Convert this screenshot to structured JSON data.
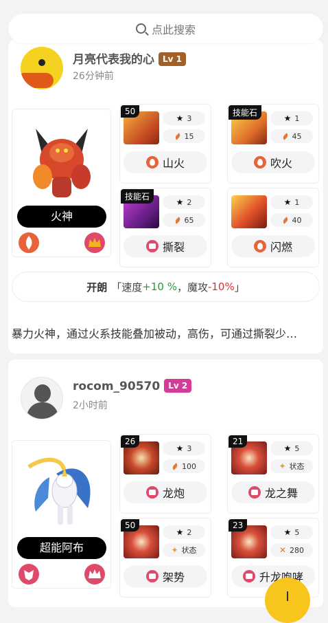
{
  "search": {
    "placeholder": "点此搜索"
  },
  "posts": [
    {
      "username": "月亮代表我的心",
      "level": "Lv 1",
      "level_color": "#a0602a",
      "time": "26分钟前",
      "monster": {
        "name": "火神",
        "types": [
          "fire-icon",
          "crown-icon"
        ]
      },
      "skills": [
        {
          "tag": "50",
          "stars": "3",
          "stat": "15",
          "stat_icon": "leaf-icon",
          "name": "山火",
          "element": "fire"
        },
        {
          "tag": "技能石",
          "stars": "1",
          "stat": "45",
          "stat_icon": "leaf-icon",
          "name": "吹火",
          "element": "fire"
        },
        {
          "tag": "技能石",
          "stars": "2",
          "stat": "65",
          "stat_icon": "leaf-icon",
          "name": "撕裂",
          "element": "fight"
        },
        {
          "tag": "",
          "stars": "1",
          "stat": "40",
          "stat_icon": "leaf-icon",
          "name": "闪燃",
          "element": "fire"
        }
      ],
      "nature": {
        "name": "开朗",
        "open": "「速度 ",
        "up": "+10 %",
        "mid": " ，魔攻",
        "down": "-10%",
        "close": " 」"
      },
      "description": "暴力火神，通过火系技能叠加被动，高伤，可通过撕裂少…"
    },
    {
      "username": "rocom_90570",
      "level": "Lv 2",
      "level_color": "#d83a9a",
      "time": "2小时前",
      "monster": {
        "name": "超能阿布",
        "types": [
          "fighting-icon",
          "crown-icon"
        ]
      },
      "skills": [
        {
          "tag": "26",
          "stars": "3",
          "stat": "100",
          "stat_icon": "leaf-icon",
          "name": "龙炮",
          "element": "fight"
        },
        {
          "tag": "21",
          "stars": "5",
          "stat": "状态",
          "stat_icon": "spark-icon",
          "name": "龙之舞",
          "element": "fight"
        },
        {
          "tag": "50",
          "stars": "2",
          "stat": "状态",
          "stat_icon": "spark-icon",
          "name": "架势",
          "element": "fight"
        },
        {
          "tag": "23",
          "stars": "5",
          "stat": "280",
          "stat_icon": "fist-icon",
          "name": "升龙咆哮",
          "element": "fight"
        }
      ]
    }
  ],
  "colors": {
    "accent": "#f8c51c",
    "stat_up": "#2a9a3a",
    "stat_down": "#d9322e"
  }
}
